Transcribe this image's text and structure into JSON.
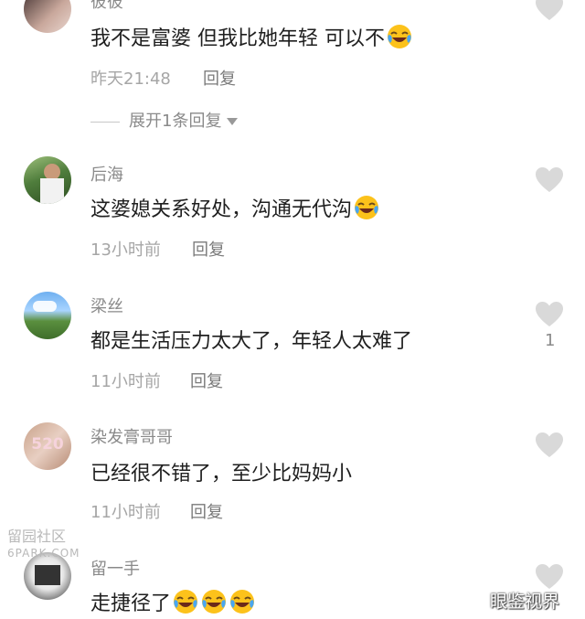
{
  "comments": [
    {
      "username": "彼彼",
      "text": "我不是富婆 但我比她年轻 可以不",
      "emoji_count": 1,
      "time": "昨天21:48",
      "reply_label": "回复",
      "expand_label": "展开1条回复"
    },
    {
      "username": "后海",
      "text": "这婆媳关系好处，沟通无代沟",
      "emoji_count": 1,
      "time": "13小时前",
      "reply_label": "回复"
    },
    {
      "username": "梁丝",
      "text": "都是生活压力太大了，年轻人太难了",
      "emoji_count": 0,
      "time": "11小时前",
      "reply_label": "回复",
      "likes": "1"
    },
    {
      "username": "染发膏哥哥",
      "text": "已经很不错了，至少比妈妈小",
      "emoji_count": 0,
      "time": "11小时前",
      "reply_label": "回复"
    },
    {
      "username": "留一手",
      "text": "走捷径了",
      "emoji_count": 3
    }
  ],
  "watermarks": {
    "left_top": "留园社区",
    "left_bottom": "6PARK.COM",
    "right": "眼鉴视界"
  },
  "colors": {
    "text": "#1f1f1f",
    "meta": "#a6a6a6",
    "heart": "#d9d9d9"
  }
}
